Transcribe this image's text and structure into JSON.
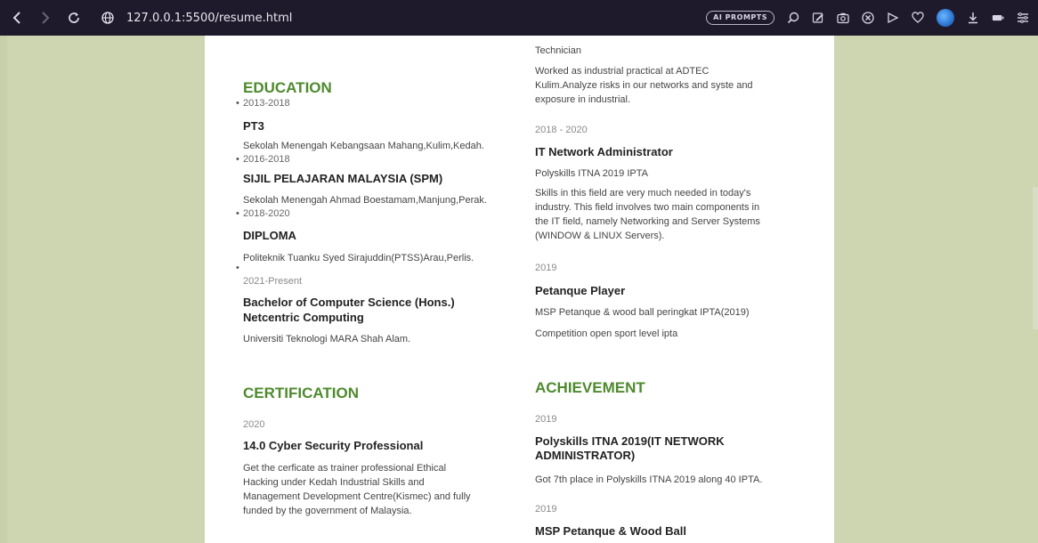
{
  "browser": {
    "url": "127.0.0.1:5500/resume.html",
    "ai_prompts_label": "AI PROMPTS",
    "icons": [
      "back-icon",
      "forward-icon",
      "reload-icon",
      "globe-icon",
      "search-icon",
      "edit-icon",
      "camera-icon",
      "shield-icon",
      "send-icon",
      "heart-icon",
      "avatar-icon",
      "download-icon",
      "battery-icon",
      "menu-icon"
    ]
  },
  "page": {
    "top_partial_left": "",
    "education": {
      "heading": "EDUCATION",
      "items": [
        {
          "years": "2013-2018",
          "title": "PT3",
          "detail": "Sekolah Menengah Kebangsaan Mahang,Kulim,Kedah."
        },
        {
          "years": "2016-2018",
          "title": "SIJIL PELAJARAN MALAYSIA (SPM)",
          "detail": "Sekolah Menengah Ahmad Boestamam,Manjung,Perak."
        },
        {
          "years": "2018-2020",
          "title": "DIPLOMA",
          "detail": "Politeknik Tuanku Syed Sirajuddin(PTSS)Arau,Perlis."
        },
        {
          "years": "2021-Present",
          "title_line1": "Bachelor of Computer Science (Hons.)",
          "title_line2": "Netcentric Computing",
          "detail": "Universiti Teknologi MARA Shah Alam."
        }
      ]
    },
    "certification": {
      "heading": "CERTIFICATION",
      "year": "2020",
      "title": "14.0 Cyber Security Professional",
      "detail_lines": [
        "Get the cerficate as trainer professional Ethical",
        "Hacking under Kedah Industrial Skills and",
        "Management Development Centre(Kismec) and fully",
        "funded by the government of Malaysia."
      ]
    },
    "experience": {
      "partial_title": "Technician",
      "partial_detail_lines": [
        "Worked as industrial practical at ADTEC",
        "Kulim.Analyze risks in our networks and syste and",
        "exposure in industrial."
      ],
      "items": [
        {
          "years": "2018 - 2020",
          "title": "IT Network Administrator",
          "org": "Polyskills ITNA 2019 IPTA",
          "detail_lines": [
            "Skills in this field are very much needed in today's",
            "industry. This field involves two main components in",
            "the IT field, namely Networking and Server Systems",
            "(WINDOW & LINUX Servers)."
          ]
        },
        {
          "years": "2019",
          "title": "Petanque Player",
          "org": "MSP Petanque & wood ball peringkat IPTA(2019)",
          "detail": "Competition open sport level ipta"
        }
      ]
    },
    "achievement": {
      "heading": "ACHIEVEMENT",
      "items": [
        {
          "year": "2019",
          "title_line1": "Polyskills ITNA 2019(IT NETWORK",
          "title_line2": "ADMINISTRATOR)",
          "detail": "Got 7th place in Polyskills ITNA 2019 along 40 IPTA."
        },
        {
          "year": "2019",
          "title": "MSP Petanque & Wood Ball"
        }
      ]
    }
  }
}
